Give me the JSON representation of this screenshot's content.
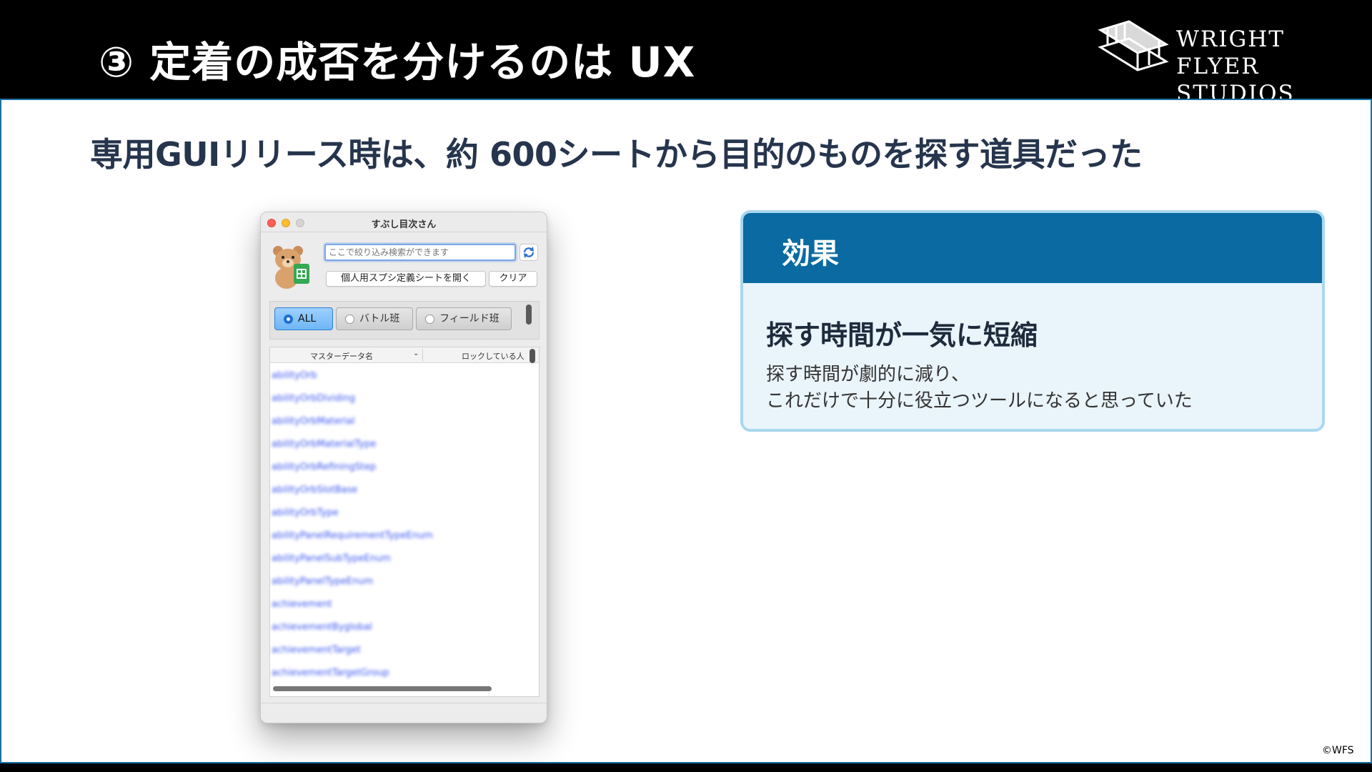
{
  "header": {
    "title": "③ 定着の成否を分けるのは UX",
    "logo_line1": "WRIGHT FLYER",
    "logo_line2": "STUDIOS"
  },
  "subtitle": "専用GUIリリース時は、約 600シートから目的のものを探す道具だった",
  "window": {
    "title": "すぶし目次さん",
    "search_placeholder": "ここで絞り込み検索ができます",
    "open_button": "個人用スプシ定義シートを開く",
    "clear_button": "クリア",
    "filters": [
      "ALL",
      "バトル班",
      "フィールド班"
    ],
    "selected_filter": "ALL",
    "columns": [
      "マスターデータ名",
      "ロックしている人"
    ],
    "rows": [
      "abilityOrb",
      "abilityOrbDividing",
      "abilityOrbMaterial",
      "abilityOrbMaterialType",
      "abilityOrbRefiningStep",
      "abilityOrbSlotBase",
      "abilityOrbType",
      "abilityPanelRequirementTypeEnum",
      "abilityPanelSubTypeEnum",
      "abilityPanelTypeEnum",
      "achievement",
      "achievementByglobal",
      "achievementTarget",
      "achievementTargetGroup"
    ]
  },
  "card": {
    "header": "効果",
    "title": "探す時間が一気に短縮",
    "body_line1": "探す時間が劇的に減り、",
    "body_line2": "これだけで十分に役立つツールになると思っていた"
  },
  "copyright": "©WFS",
  "colors": {
    "accent": "#0a6aa1",
    "card_bg": "#eaf4fb",
    "card_border": "#a9d8f0",
    "heading_text": "#26354d",
    "selected_filter": "#6db6f5"
  }
}
